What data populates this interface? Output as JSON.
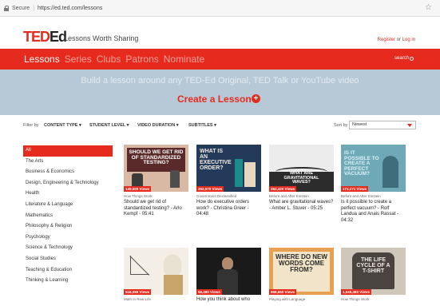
{
  "browser": {
    "secure_label": "Secure",
    "url": "https://ed.ted.com/lessons",
    "star": "☆"
  },
  "header": {
    "logo_ted": "TED",
    "logo_ed": "Ed",
    "tagline": "Lessons Worth Sharing",
    "register": "Register",
    "or": " or ",
    "login": "Log in"
  },
  "nav": {
    "items": [
      "Lessons",
      "Series",
      "Clubs",
      "Patrons",
      "Nominate"
    ],
    "search": "search"
  },
  "hero": {
    "blurb": "Build a lesson around any TED-Ed Original, TED Talk or YouTube video",
    "cta": "Create a Lesson",
    "plus": "+"
  },
  "filters": {
    "label": "Filter by",
    "content_type": "CONTENT TYPE ▾",
    "student_level": "STUDENT LEVEL ▾",
    "video_duration": "VIDEO DURATION ▾",
    "subtitles": "SUBTITLES ▾",
    "sort_label": "Sort by",
    "sort_value": "Newest"
  },
  "sidebar": {
    "items": [
      "All",
      "The Arts",
      "Business & Economics",
      "Design, Engineering & Technology",
      "Health",
      "Literature & Language",
      "Mathematics",
      "Philosophy & Religion",
      "Psychology",
      "Science & Technology",
      "Social Studies",
      "Teaching & Education",
      "Thinking & Learning"
    ]
  },
  "cards": [
    {
      "series": "How Things Work",
      "title": "Should we get rid of standardized testing? - Arlo Kempf - 05:41",
      "views": "149,500",
      "thumb_text": "SHOULD WE GET RID OF STANDARDIZED TESTING?"
    },
    {
      "series": "Government Declassified",
      "title": "How do executive orders work? - Christina Greer - 04:48",
      "views": "392,570",
      "thumb_text": "WHAT IS AN EXECUTIVE ORDER?"
    },
    {
      "series": "Before and After Einstein",
      "title": "What are gravitational waves? - Amber L. Stuver - 05:25",
      "views": "262,420",
      "thumb_text": "WHAT ARE GRAVITATIONAL WAVES?"
    },
    {
      "series": "Before and After Einstein",
      "title": "Is it possible to create a perfect vacuum? - Rolf Landua and Anais Rassat - 04:32",
      "views": "173,171",
      "thumb_text": "IS IT POSSIBLE TO CREATE A PERFECT VACUUM?"
    },
    {
      "series": "Math In Real Life",
      "title": "",
      "views": "516,096",
      "thumb_text": ""
    },
    {
      "series": "",
      "title": "How you think about who",
      "views": "56,480",
      "thumb_text": ""
    },
    {
      "series": "Playing with Language",
      "title": "",
      "views": "966,650",
      "thumb_text": "WHERE DO NEW WORDS COME FROM?"
    },
    {
      "series": "How Things Work",
      "title": "",
      "views": "1,040,483",
      "thumb_text": "THE LIFE CYCLE OF A T-SHIRT"
    }
  ],
  "views_label": "Views",
  "colors": {
    "accent": "#e62b1e",
    "hero": "#b7c9d7"
  }
}
